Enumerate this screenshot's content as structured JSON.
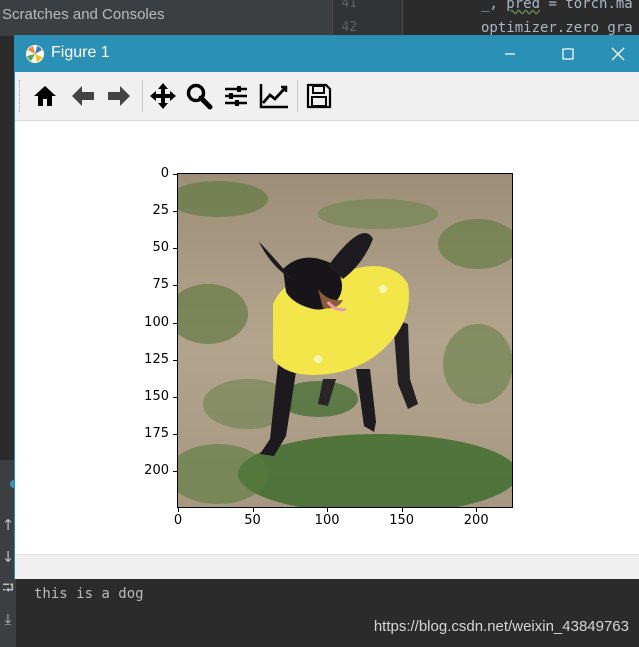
{
  "ide": {
    "panel_title": "Scratches and Consoles",
    "line_numbers": [
      "41",
      "42"
    ],
    "code_line_1_prefix": "_, ",
    "code_line_1_pred": "pred",
    "code_line_1_rest": " = torch.ma",
    "code_line_2": "optimizer.zero_gra",
    "console_output": "this is a dog"
  },
  "figure": {
    "title": "Figure 1",
    "toolbar": [
      "home-icon",
      "back-arrow-icon",
      "forward-arrow-icon",
      "pan-icon",
      "zoom-icon",
      "subplots-config-icon",
      "edit-axis-icon",
      "save-icon"
    ]
  },
  "image_plot": {
    "y_ticks": [
      {
        "value": 0,
        "label": "0"
      },
      {
        "value": 25,
        "label": "25"
      },
      {
        "value": 50,
        "label": "50"
      },
      {
        "value": 75,
        "label": "75"
      },
      {
        "value": 100,
        "label": "100"
      },
      {
        "value": 125,
        "label": "125"
      },
      {
        "value": 150,
        "label": "150"
      },
      {
        "value": 175,
        "label": "175"
      },
      {
        "value": 200,
        "label": "200"
      }
    ],
    "x_ticks": [
      {
        "value": 0,
        "label": "0"
      },
      {
        "value": 50,
        "label": "50"
      },
      {
        "value": 100,
        "label": "100"
      },
      {
        "value": 150,
        "label": "150"
      },
      {
        "value": 200,
        "label": "200"
      }
    ],
    "range": [
      0,
      224
    ]
  },
  "watermark": "https://blog.csdn.net/weixin_43849763",
  "colors": {
    "titlebar": "#2b90b5",
    "dog_sweater": "#f3e64a",
    "ground": "#a89a82",
    "grass": "#4f7a3a"
  }
}
